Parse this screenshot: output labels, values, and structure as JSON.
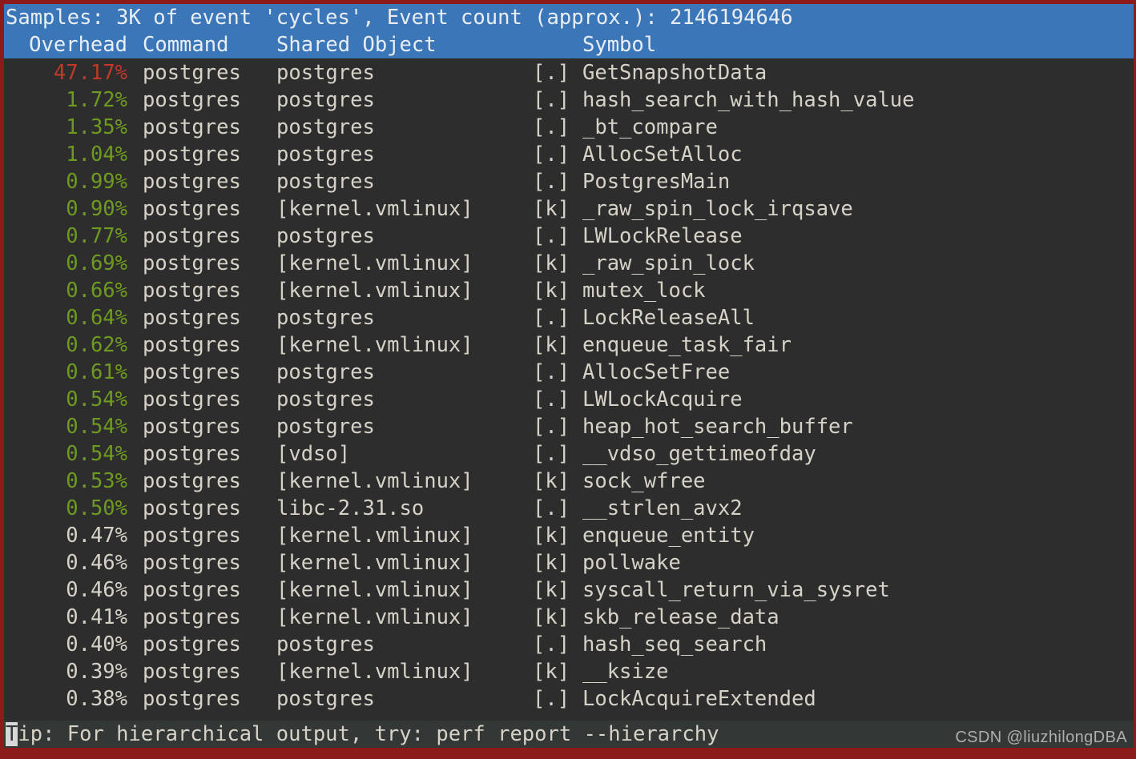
{
  "header": {
    "samples_line": "Samples: 3K of event 'cycles', Event count (approx.): 2146194646",
    "columns": {
      "overhead": "Overhead",
      "command": "Command",
      "shared_object": "Shared Object",
      "symbol": "Symbol"
    },
    "bg_color": "#3a76b8",
    "fg_color": "#e9eef5"
  },
  "colors": {
    "terminal_bg": "#2d2d2d",
    "border": "#8b1a1a",
    "text": "#d7d2c8",
    "pct_hot": "#c0392b",
    "pct_warm": "#6f9a22",
    "status_bg": "#333735"
  },
  "rows": [
    {
      "overhead": "47.17%",
      "command": "postgres",
      "dso": "postgres",
      "level": "[.]",
      "symbol": "GetSnapshotData",
      "heat": "hot"
    },
    {
      "overhead": "1.72%",
      "command": "postgres",
      "dso": "postgres",
      "level": "[.]",
      "symbol": "hash_search_with_hash_value",
      "heat": "warm"
    },
    {
      "overhead": "1.35%",
      "command": "postgres",
      "dso": "postgres",
      "level": "[.]",
      "symbol": "_bt_compare",
      "heat": "warm"
    },
    {
      "overhead": "1.04%",
      "command": "postgres",
      "dso": "postgres",
      "level": "[.]",
      "symbol": "AllocSetAlloc",
      "heat": "warm"
    },
    {
      "overhead": "0.99%",
      "command": "postgres",
      "dso": "postgres",
      "level": "[.]",
      "symbol": "PostgresMain",
      "heat": "warm"
    },
    {
      "overhead": "0.90%",
      "command": "postgres",
      "dso": "[kernel.vmlinux]",
      "level": "[k]",
      "symbol": "_raw_spin_lock_irqsave",
      "heat": "warm"
    },
    {
      "overhead": "0.77%",
      "command": "postgres",
      "dso": "postgres",
      "level": "[.]",
      "symbol": "LWLockRelease",
      "heat": "warm"
    },
    {
      "overhead": "0.69%",
      "command": "postgres",
      "dso": "[kernel.vmlinux]",
      "level": "[k]",
      "symbol": "_raw_spin_lock",
      "heat": "warm"
    },
    {
      "overhead": "0.66%",
      "command": "postgres",
      "dso": "[kernel.vmlinux]",
      "level": "[k]",
      "symbol": "mutex_lock",
      "heat": "warm"
    },
    {
      "overhead": "0.64%",
      "command": "postgres",
      "dso": "postgres",
      "level": "[.]",
      "symbol": "LockReleaseAll",
      "heat": "warm"
    },
    {
      "overhead": "0.62%",
      "command": "postgres",
      "dso": "[kernel.vmlinux]",
      "level": "[k]",
      "symbol": "enqueue_task_fair",
      "heat": "warm"
    },
    {
      "overhead": "0.61%",
      "command": "postgres",
      "dso": "postgres",
      "level": "[.]",
      "symbol": "AllocSetFree",
      "heat": "warm"
    },
    {
      "overhead": "0.54%",
      "command": "postgres",
      "dso": "postgres",
      "level": "[.]",
      "symbol": "LWLockAcquire",
      "heat": "warm"
    },
    {
      "overhead": "0.54%",
      "command": "postgres",
      "dso": "postgres",
      "level": "[.]",
      "symbol": "heap_hot_search_buffer",
      "heat": "warm"
    },
    {
      "overhead": "0.54%",
      "command": "postgres",
      "dso": "[vdso]",
      "level": "[.]",
      "symbol": "__vdso_gettimeofday",
      "heat": "warm"
    },
    {
      "overhead": "0.53%",
      "command": "postgres",
      "dso": "[kernel.vmlinux]",
      "level": "[k]",
      "symbol": "sock_wfree",
      "heat": "warm"
    },
    {
      "overhead": "0.50%",
      "command": "postgres",
      "dso": "libc-2.31.so",
      "level": "[.]",
      "symbol": "__strlen_avx2",
      "heat": "warm"
    },
    {
      "overhead": "0.47%",
      "command": "postgres",
      "dso": "[kernel.vmlinux]",
      "level": "[k]",
      "symbol": "enqueue_entity",
      "heat": "cool"
    },
    {
      "overhead": "0.46%",
      "command": "postgres",
      "dso": "[kernel.vmlinux]",
      "level": "[k]",
      "symbol": "pollwake",
      "heat": "cool"
    },
    {
      "overhead": "0.46%",
      "command": "postgres",
      "dso": "[kernel.vmlinux]",
      "level": "[k]",
      "symbol": "syscall_return_via_sysret",
      "heat": "cool"
    },
    {
      "overhead": "0.41%",
      "command": "postgres",
      "dso": "[kernel.vmlinux]",
      "level": "[k]",
      "symbol": "skb_release_data",
      "heat": "cool"
    },
    {
      "overhead": "0.40%",
      "command": "postgres",
      "dso": "postgres",
      "level": "[.]",
      "symbol": "hash_seq_search",
      "heat": "cool"
    },
    {
      "overhead": "0.39%",
      "command": "postgres",
      "dso": "[kernel.vmlinux]",
      "level": "[k]",
      "symbol": "__ksize",
      "heat": "cool"
    },
    {
      "overhead": "0.38%",
      "command": "postgres",
      "dso": "postgres",
      "level": "[.]",
      "symbol": "LockAcquireExtended",
      "heat": "cool"
    }
  ],
  "status": {
    "cursor_char": "T",
    "tip_text": "ip: For hierarchical output, try: perf report --hierarchy"
  },
  "watermark": "CSDN @liuzhilongDBA"
}
